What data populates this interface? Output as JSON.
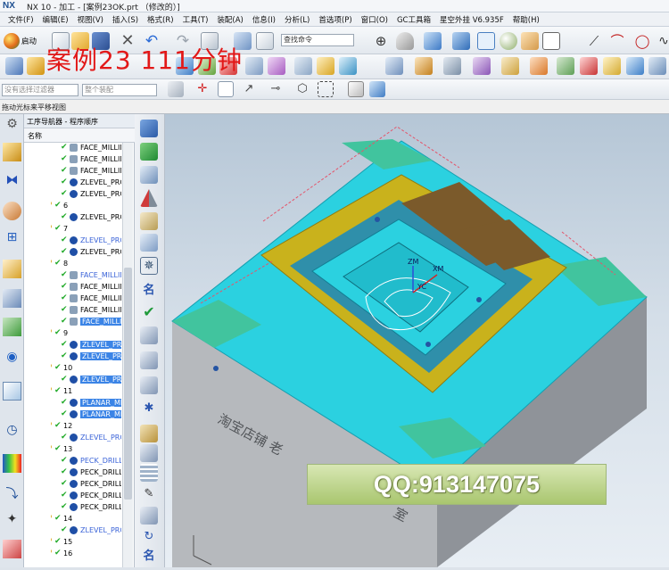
{
  "titlebar": {
    "logo": "NX",
    "title": "NX 10 - 加工 - [案例23OK.prt （修改的）]"
  },
  "menus": [
    "文件(F)",
    "编辑(E)",
    "视图(V)",
    "插入(S)",
    "格式(R)",
    "工具(T)",
    "装配(A)",
    "信息(I)",
    "分析(L)",
    "首选项(P)",
    "窗口(O)",
    "GC工具箱",
    "星空外挂 V6.935F",
    "帮助(H)"
  ],
  "toolbar": {
    "start_label": "启动",
    "find_command_placeholder": "查找命令",
    "selection_filter_placeholder": "没有选择过滤器",
    "assembly_scope": "整个装配"
  },
  "hint": "拖动光标来平移视图",
  "overlay": {
    "title": "案例23    111分钟",
    "qq": "QQ:913147075"
  },
  "navigator": {
    "title": "工序导航器 - 程序顺序",
    "column": "名称",
    "rows": [
      {
        "label": "FACE_MILLIN",
        "kind": "face",
        "style": "normal"
      },
      {
        "label": "FACE_MILLIN",
        "kind": "face",
        "style": "normal"
      },
      {
        "label": "FACE_MILLIN",
        "kind": "face",
        "style": "normal"
      },
      {
        "label": "ZLEVEL_PRO",
        "kind": "zlevel",
        "style": "normal"
      },
      {
        "label": "ZLEVEL_PRO",
        "kind": "zlevel",
        "style": "normal"
      },
      {
        "label": "6",
        "kind": "group",
        "style": "group"
      },
      {
        "label": "ZLEVEL_PRO",
        "kind": "zlevel",
        "style": "normal"
      },
      {
        "label": "7",
        "kind": "group",
        "style": "group"
      },
      {
        "label": "ZLEVEL_PRO",
        "kind": "zlevel",
        "style": "blue"
      },
      {
        "label": "ZLEVEL_PRO",
        "kind": "zlevel",
        "style": "normal"
      },
      {
        "label": "8",
        "kind": "group",
        "style": "group"
      },
      {
        "label": "FACE_MILLIN",
        "kind": "face",
        "style": "blue"
      },
      {
        "label": "FACE_MILLIN",
        "kind": "face",
        "style": "normal"
      },
      {
        "label": "FACE_MILLIN",
        "kind": "face",
        "style": "normal"
      },
      {
        "label": "FACE_MILLIN",
        "kind": "face",
        "style": "normal"
      },
      {
        "label": "FACE_MILLIN",
        "kind": "face",
        "style": "selected"
      },
      {
        "label": "9",
        "kind": "group",
        "style": "group"
      },
      {
        "label": "ZLEVEL_PRO",
        "kind": "zlevel",
        "style": "selected"
      },
      {
        "label": "ZLEVEL_PRO",
        "kind": "zlevel",
        "style": "selected"
      },
      {
        "label": "10",
        "kind": "group",
        "style": "group"
      },
      {
        "label": "ZLEVEL_PRO",
        "kind": "zlevel",
        "style": "selected"
      },
      {
        "label": "11",
        "kind": "group",
        "style": "group"
      },
      {
        "label": "PLANAR_MIL",
        "kind": "planar",
        "style": "selected"
      },
      {
        "label": "PLANAR_MIL",
        "kind": "planar",
        "style": "selected"
      },
      {
        "label": "12",
        "kind": "group",
        "style": "group"
      },
      {
        "label": "ZLEVEL_PRO",
        "kind": "zlevel",
        "style": "blue"
      },
      {
        "label": "13",
        "kind": "group",
        "style": "group"
      },
      {
        "label": "PECK_DRILLI",
        "kind": "drill",
        "style": "blue"
      },
      {
        "label": "PECK_DRILLI",
        "kind": "drill",
        "style": "normal"
      },
      {
        "label": "PECK_DRILLI",
        "kind": "drill",
        "style": "normal"
      },
      {
        "label": "PECK_DRILLI",
        "kind": "drill",
        "style": "normal"
      },
      {
        "label": "PECK_DRILLI",
        "kind": "drill",
        "style": "normal"
      },
      {
        "label": "14",
        "kind": "group",
        "style": "group"
      },
      {
        "label": "ZLEVEL_PRO",
        "kind": "zlevel",
        "style": "blue"
      },
      {
        "label": "15",
        "kind": "group",
        "style": "group"
      },
      {
        "label": "16",
        "kind": "group",
        "style": "group"
      }
    ]
  },
  "model": {
    "stamp_text": "淘宝店铺 老",
    "stamp_text2": "室",
    "axis_zm": "ZM",
    "axis_xm": "XM",
    "axis_yc": "YC"
  },
  "colors": {
    "cyan": "#2bd1e0",
    "yellow": "#c9b21c",
    "body": "#b9bcc0",
    "overlay_red": "#e21818",
    "selection": "#3b84e6"
  }
}
